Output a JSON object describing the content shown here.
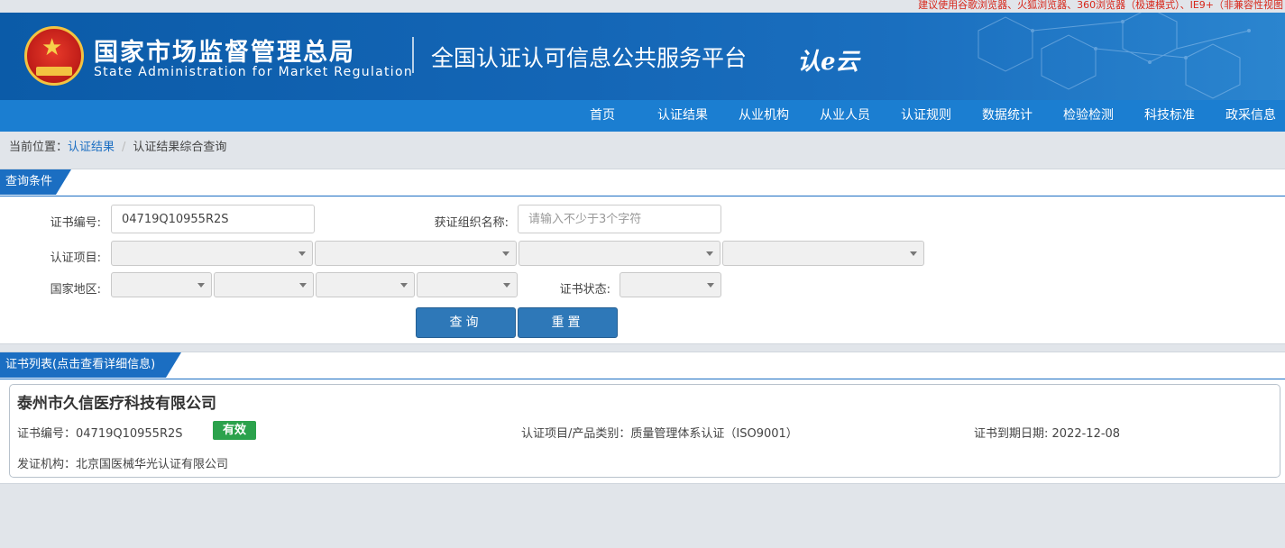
{
  "top_notice": "建议使用谷歌浏览器、火狐浏览器、360浏览器（极速模式）、IE9+（非兼容性视图",
  "header": {
    "org_cn": "国家市场监督管理总局",
    "org_en": "State Administration  for  Market Regulation",
    "platform": "全国认证认可信息公共服务平台",
    "logo_text": "认e云",
    "emblem_icon": "national-emblem-icon"
  },
  "nav": {
    "items": [
      "首页",
      "认证结果",
      "从业机构",
      "从业人员",
      "认证规则",
      "数据统计",
      "检验检测",
      "科技标准",
      "政采信息"
    ]
  },
  "breadcrumb": {
    "prefix": "当前位置：",
    "link": "认证结果",
    "current": "认证结果综合查询"
  },
  "query": {
    "title": "查询条件",
    "cert_no_label": "证书编号:",
    "cert_no_value": "04719Q10955R2S",
    "org_name_label": "获证组织名称:",
    "org_name_placeholder": "请输入不少于3个字符",
    "project_label": "认证项目:",
    "region_label": "国家地区:",
    "status_label": "证书状态:",
    "search_button": "查询",
    "reset_button": "重置"
  },
  "results": {
    "title": "证书列表(点击查看详细信息)",
    "items": [
      {
        "company": "泰州市久信医疗科技有限公司",
        "cert_no_label": "证书编号：",
        "cert_no": "04719Q10955R2S",
        "status": "有效",
        "project_label": "认证项目/产品类别：",
        "project": "质量管理体系认证（ISO9001）",
        "expiry_label": "证书到期日期:",
        "expiry": "2022-12-08",
        "issuer_label": "发证机构：",
        "issuer": "北京国医械华光认证有限公司"
      }
    ]
  },
  "colors": {
    "brand_blue": "#1b6ec2",
    "nav_blue": "#1b7ed1",
    "header_blue": "#0b5ba8",
    "valid_green": "#2ba24c",
    "notice_red": "#d7261a"
  }
}
